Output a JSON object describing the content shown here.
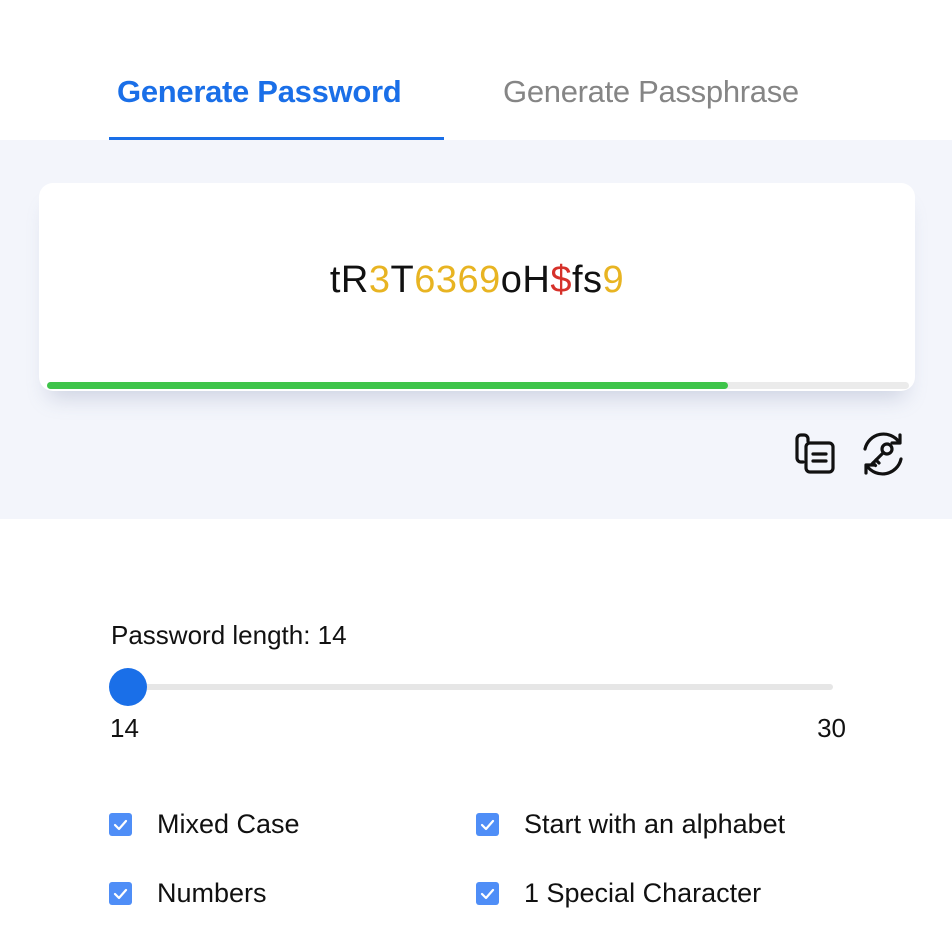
{
  "tabs": {
    "active": "Generate Password",
    "inactive": "Generate Passphrase"
  },
  "password": {
    "segments": [
      {
        "text": "tR",
        "color": "#111111"
      },
      {
        "text": "3",
        "color": "#e8b422"
      },
      {
        "text": "T",
        "color": "#111111"
      },
      {
        "text": "6369",
        "color": "#e8b422"
      },
      {
        "text": "oH",
        "color": "#111111"
      },
      {
        "text": "$",
        "color": "#d6312a"
      },
      {
        "text": "fs",
        "color": "#111111"
      },
      {
        "text": "9",
        "color": "#e8b422"
      }
    ],
    "strength_percent": 79,
    "strength_color": "#3ec44a"
  },
  "actions": {
    "copy_icon": "copy-icon",
    "regenerate_icon": "regenerate-key-icon"
  },
  "length": {
    "label": "Password length: 14",
    "value": 14,
    "min": "14",
    "max": "30"
  },
  "options": [
    {
      "label": "Mixed Case",
      "checked": true
    },
    {
      "label": "Start with an alphabet",
      "checked": true
    },
    {
      "label": "Numbers",
      "checked": true
    },
    {
      "label": "1 Special Character",
      "checked": true
    }
  ],
  "colors": {
    "accent": "#1a6fe8",
    "checkbox": "#4f8ef7",
    "panel_bg": "#f3f5fb"
  }
}
